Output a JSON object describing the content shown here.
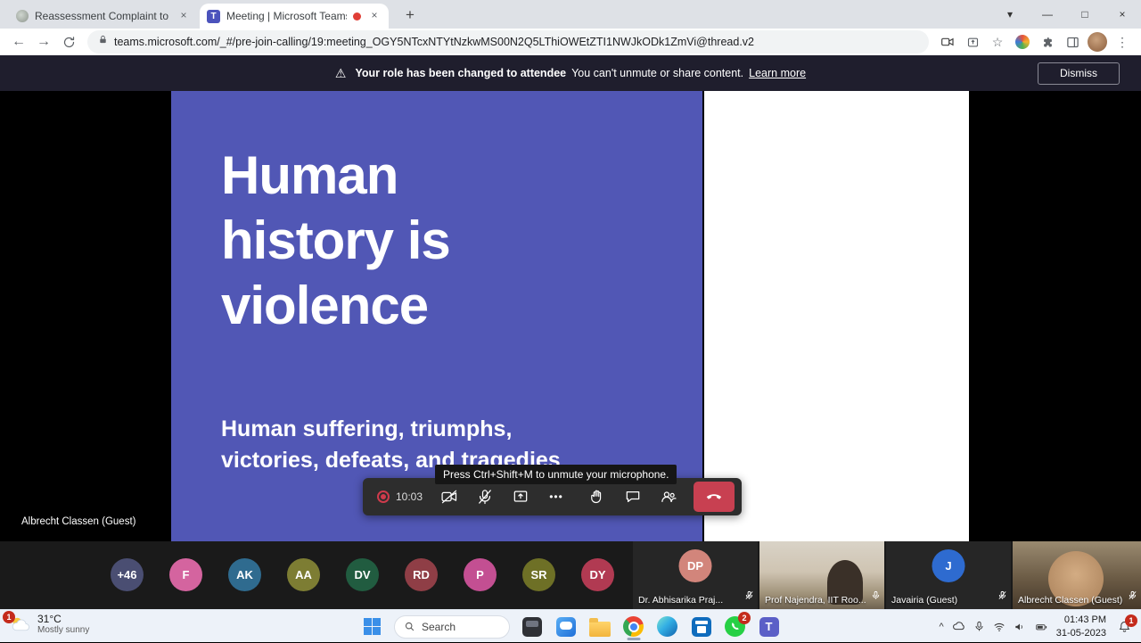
{
  "icons": {
    "warning": "⚠",
    "close": "×",
    "new_tab": "+",
    "back": "←",
    "forward": "→",
    "star": "☆",
    "kebab": "⋮",
    "more": "•••",
    "minimize": "—",
    "maximize": "□",
    "tab_chevron": "▾",
    "tray_chevron": "^"
  },
  "browser": {
    "tab1_title": "Reassessment Complaint to Univ",
    "tab2_title": "Meeting | Microsoft Teams",
    "url": "teams.microsoft.com/_#/pre-join-calling/19:meeting_OGY5NTcxNTYtNzkwMS00N2Q5LThiOWEtZTI1NWJkODk1ZmVi@thread.v2"
  },
  "banner": {
    "title": "Your role has been changed to attendee",
    "message": "You can't unmute or share content.",
    "link": "Learn more",
    "dismiss": "Dismiss"
  },
  "slide": {
    "bg": "#5157b5",
    "title": "Human history is violence",
    "subtitle1": "Human suffering, triumphs,",
    "subtitle2": "victories, defeats, and tragedies"
  },
  "stage": {
    "presenter_label": "Albrecht Classen (Guest)"
  },
  "tooltip": {
    "text": "Press Ctrl+Shift+M to unmute your microphone."
  },
  "call": {
    "timer": "10:03",
    "hangup_color": "#c84051"
  },
  "participants": {
    "overflow": {
      "label": "+46",
      "color": "#4a4e72"
    },
    "avatars": [
      {
        "initials": "F",
        "color": "#d4649f"
      },
      {
        "initials": "AK",
        "color": "#2f6b8f"
      },
      {
        "initials": "AA",
        "color": "#7d7d33"
      },
      {
        "initials": "DV",
        "color": "#215c40"
      },
      {
        "initials": "RD",
        "color": "#8f3e46"
      },
      {
        "initials": "P",
        "color": "#c34f92"
      },
      {
        "initials": "SR",
        "color": "#6e7026"
      },
      {
        "initials": "DY",
        "color": "#b13a52"
      }
    ],
    "tiles": [
      {
        "name": "Dr. Abhisarika Praj...",
        "initials": "DP",
        "color": "#d2857b"
      },
      {
        "name": "Prof Najendra, IIT Roo..."
      },
      {
        "name": "Javairia (Guest)",
        "initials": "J",
        "color": "#2e6bd0"
      },
      {
        "name": "Albrecht Classen (Guest)"
      }
    ]
  },
  "taskbar": {
    "weather_temp": "31°C",
    "weather_desc": "Mostly sunny",
    "weather_badge": "1",
    "search": "Search",
    "whatsapp_badge": "2",
    "time": "01:43 PM",
    "date": "31-05-2023",
    "notification_badge": "1"
  }
}
